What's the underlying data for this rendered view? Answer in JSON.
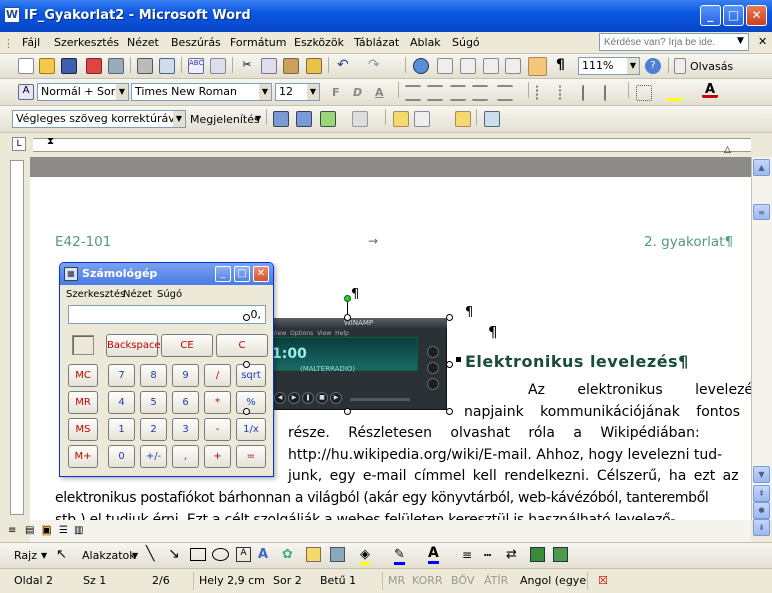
{
  "window": {
    "title": "IF_Gyakorlat2 - Microsoft Word",
    "app_icon": "W"
  },
  "menu": {
    "items": [
      "Fájl",
      "Szerkesztés",
      "Nézet",
      "Beszúrás",
      "Formátum",
      "Eszközök",
      "Táblázat",
      "Ablak",
      "Súgó"
    ],
    "help_placeholder": "Kérdése van? Írja be ide."
  },
  "toolbar": {
    "zoom": "111%",
    "read_label": "Olvasás",
    "style": "Normál + Sorkiz",
    "font": "Times New Roman",
    "size": "12",
    "bold": "F",
    "italic": "D",
    "underline": "A",
    "pilcrow": "¶",
    "review_mode": "Végleges szöveg korrektúrával",
    "show_label": "Megjelenítés"
  },
  "document": {
    "header_left": "E42-101",
    "header_right": "2. gyakorlat¶",
    "arrow": "→",
    "pilcrow1": "¶",
    "pilcrow2": "¶",
    "pilcrow3": "¶",
    "heading": "Elektronikus levelezés¶",
    "lines": [
      "Az elektronikus levelezés",
      "napjaink kommunikációjának fontos",
      "része. Részletesen olvashat róla a Wikipédiában:",
      "http://hu.wikipedia.org/wiki/E-mail. Ahhoz, hogy levelezni tud-",
      "junk, egy e-mail címmel kell rendelkezni. Célszerű, ha ezt az",
      "elektronikus postafiókot bárhonnan a világból (akár egy könyvtárból, web-kávézóból, tanteremből",
      "stb.) el tudjuk érni. Ezt a célt szolgálják a webes felületen keresztül is használható levelező-"
    ]
  },
  "calculator": {
    "title": "Számológép",
    "menu": [
      "Szerkesztés",
      "Nézet",
      "Súgó"
    ],
    "display": "0,",
    "top_buttons": [
      "Backspace",
      "CE",
      "C"
    ],
    "rows": [
      [
        "MC",
        "7",
        "8",
        "9",
        "/",
        "sqrt"
      ],
      [
        "MR",
        "4",
        "5",
        "6",
        "*",
        "%"
      ],
      [
        "MS",
        "1",
        "2",
        "3",
        "-",
        "1/x"
      ],
      [
        "M+",
        "0",
        "+/-",
        ",",
        "+",
        "="
      ]
    ]
  },
  "winamp": {
    "title": "WINAMP",
    "time": "1:00",
    "track": "(MALTERRADIO)",
    "menu": [
      "View",
      "Options",
      "View",
      "Help"
    ]
  },
  "drawing_toolbar": {
    "draw_label": "Rajz",
    "shapes_label": "Alakzatok"
  },
  "status": {
    "page": "Oldal  2",
    "section": "Sz  1",
    "pages": "2/6",
    "at": "Hely  2,9 cm",
    "line": "Sor  2",
    "col": "Betű  1",
    "rec": "MR",
    "trk": "KORR",
    "ext": "BŐV",
    "ovr": "ÁTÍR",
    "lang": "Angol (egye"
  }
}
